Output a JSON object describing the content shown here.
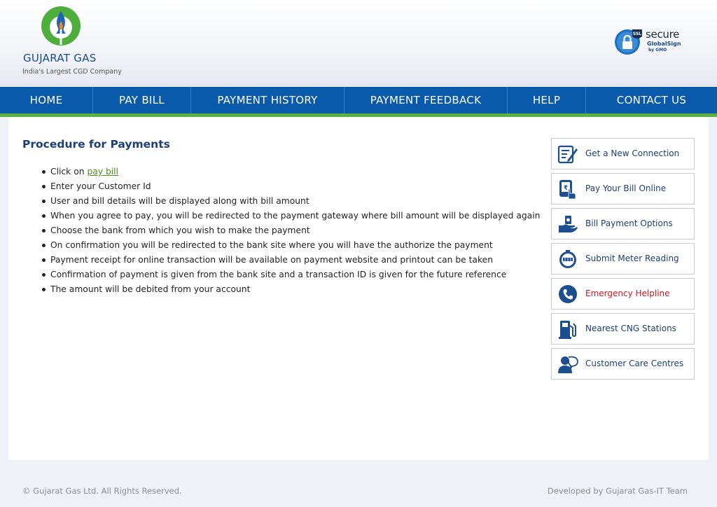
{
  "brand": {
    "name": "GUJARAT GAS",
    "tagline": "India's Largest CGD Company",
    "colors": {
      "blue": "#0a5aac",
      "green": "#5ab13f",
      "title": "#1b3f75"
    }
  },
  "security_badge": {
    "ssl": "SSL",
    "secure": "secure",
    "provider": "GlobalSign",
    "by": "by GMO"
  },
  "nav": {
    "items": [
      {
        "label": "HOME"
      },
      {
        "label": "PAY BILL"
      },
      {
        "label": "PAYMENT HISTORY"
      },
      {
        "label": "PAYMENT FEEDBACK"
      },
      {
        "label": "HELP"
      },
      {
        "label": "CONTACT US"
      }
    ]
  },
  "procedure": {
    "title": "Procedure for Payments",
    "first_step_prefix": "Click on ",
    "first_step_link": "pay bill",
    "steps": [
      "Enter your Customer Id",
      "User and bill details will be displayed along with bill amount",
      "When you agree to pay, you will be redirected to the payment gateway where bill amount will be displayed again",
      "Choose the bank from which you wish to make the payment",
      "On confirmation you will be redirected to the bank site where you will have the authorize the payment",
      "Payment receipt for online transaction will be available on payment website and printout can be taken",
      "Confirmation of payment is given from the bank site and a transaction ID is given for the future reference",
      "The amount will be debited from your account"
    ]
  },
  "quick_links": [
    {
      "label": "Get a New Connection",
      "icon": "form-edit-icon"
    },
    {
      "label": "Pay Your Bill Online",
      "icon": "touch-pay-icon"
    },
    {
      "label": "Bill Payment Options",
      "icon": "hand-money-icon"
    },
    {
      "label": "Submit Meter Reading",
      "icon": "meter-icon"
    },
    {
      "label": "Emergency Helpline",
      "icon": "phone-icon"
    },
    {
      "label": "Nearest CNG Stations",
      "icon": "fuel-pump-icon"
    },
    {
      "label": "Customer Care Centres",
      "icon": "customer-care-icon"
    }
  ],
  "footer": {
    "copyright": "© Gujarat Gas Ltd.  All Rights Reserved.",
    "developer": "Developed by Gujarat Gas-IT Team"
  }
}
